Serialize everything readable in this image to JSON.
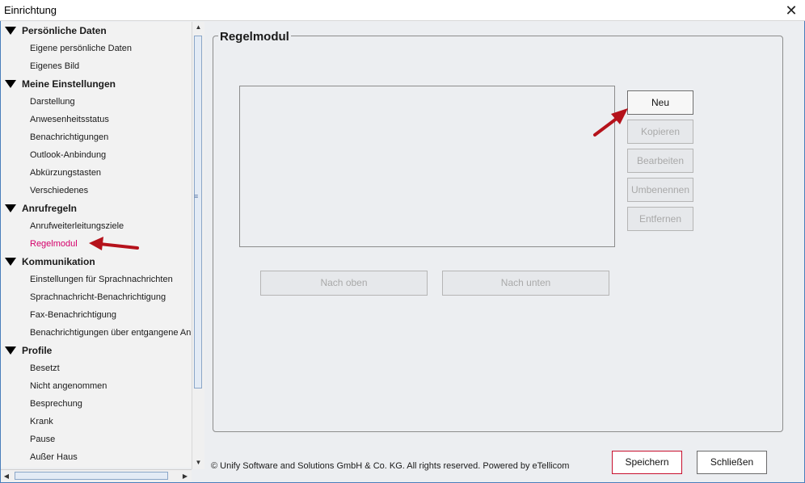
{
  "window": {
    "title": "Einrichtung",
    "close_glyph": "✕"
  },
  "sidebar": {
    "groups": [
      {
        "label": "Persönliche Daten",
        "items": [
          "Eigene persönliche Daten",
          "Eigenes Bild"
        ]
      },
      {
        "label": "Meine Einstellungen",
        "items": [
          "Darstellung",
          "Anwesenheitsstatus",
          "Benachrichtigungen",
          "Outlook-Anbindung",
          "Abkürzungstasten",
          "Verschiedenes"
        ]
      },
      {
        "label": "Anrufregeln",
        "items": [
          "Anrufweiterleitungsziele",
          "Regelmodul"
        ]
      },
      {
        "label": "Kommunikation",
        "items": [
          "Einstellungen für Sprachnachrichten",
          "Sprachnachricht-Benachrichtigung",
          "Fax-Benachrichtigung",
          "Benachrichtigungen über entgangene An"
        ]
      },
      {
        "label": "Profile",
        "items": [
          "Besetzt",
          "Nicht angenommen",
          "Besprechung",
          "Krank",
          "Pause",
          "Außer Haus"
        ]
      }
    ],
    "selected": "Regelmodul",
    "selected_color": "#d4006a"
  },
  "main": {
    "section_title": "Regelmodul",
    "buttons": {
      "new": "Neu",
      "copy": "Kopieren",
      "edit": "Bearbeiten",
      "rename": "Umbenennen",
      "remove": "Entfernen",
      "move_up": "Nach oben",
      "move_down": "Nach unten"
    }
  },
  "footer": {
    "copyright": "© Unify Software and Solutions GmbH & Co. KG. All rights reserved. Powered by eTellicom",
    "save": "Speichern",
    "close": "Schließen"
  },
  "icons": {
    "tree_expanded": "triangle-down-icon",
    "window_close": "close-icon",
    "annotation": "red-arrow-icon"
  },
  "colors": {
    "annotation_arrow": "#b5121b",
    "save_border": "#c8102e",
    "window_border": "#4a7ebb"
  }
}
